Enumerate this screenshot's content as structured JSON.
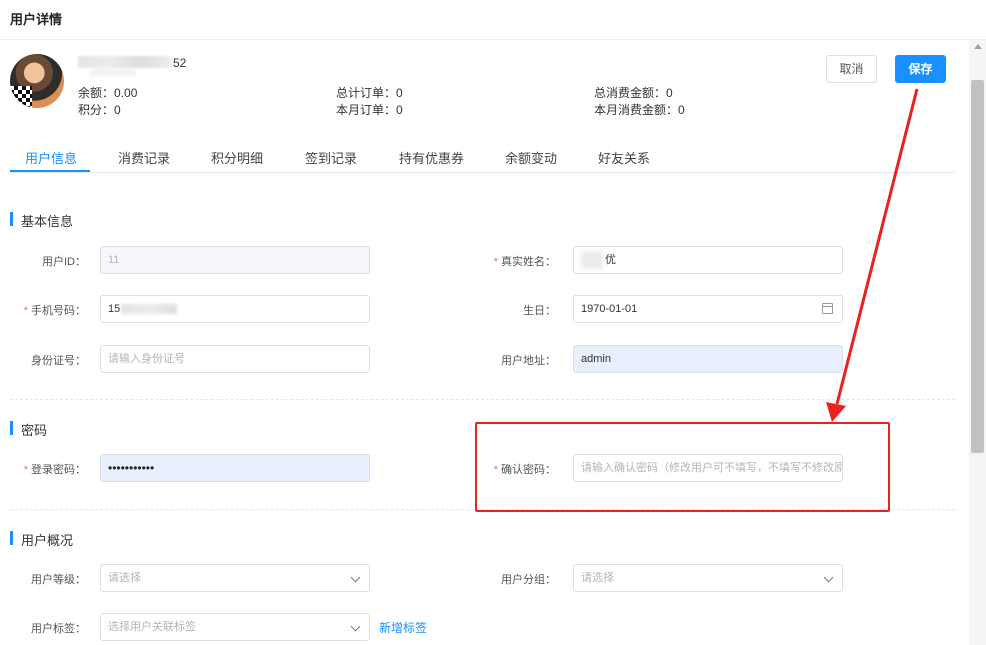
{
  "page": {
    "title": "用户详情"
  },
  "user": {
    "name_suffix": "52",
    "stats": {
      "balance_label": "余额：",
      "balance": "0.00",
      "points_label": "积分：",
      "points": "0",
      "total_orders_label": "总计订单：",
      "total_orders": "0",
      "month_orders_label": "本月订单：",
      "month_orders": "0",
      "total_spend_label": "总消费金额：",
      "total_spend": "0",
      "month_spend_label": "本月消费金额：",
      "month_spend": "0"
    }
  },
  "actions": {
    "cancel": "取消",
    "save": "保存"
  },
  "tabs": [
    "用户信息",
    "消费记录",
    "积分明细",
    "签到记录",
    "持有优惠券",
    "余额变动",
    "好友关系"
  ],
  "basic": {
    "title": "基本信息",
    "user_id_label": "用户ID：",
    "user_id": "11",
    "real_name_label": "真实姓名：",
    "real_name_tail": "优",
    "phone_label": "手机号码：",
    "phone_prefix": "15",
    "birthday_label": "生日：",
    "birthday": "1970-01-01",
    "idcard_label": "身份证号：",
    "idcard_placeholder": "请输入身份证号",
    "address_label": "用户地址：",
    "address": "admin"
  },
  "password": {
    "title": "密码",
    "login_label": "登录密码：",
    "login_value": "•••••••••••",
    "confirm_label": "确认密码：",
    "confirm_placeholder": "请输入确认密码（修改用户可不填写，不填写不修改原"
  },
  "overview": {
    "title": "用户概况",
    "level_label": "用户等级：",
    "level_placeholder": "请选择",
    "group_label": "用户分组：",
    "group_placeholder": "请选择",
    "tag_label": "用户标签：",
    "tag_placeholder": "选择用户关联标签",
    "add_tag": "新增标签"
  },
  "colors": {
    "accent": "#1890ff",
    "required": "#f56c6c",
    "annotation": "#e8221d"
  }
}
